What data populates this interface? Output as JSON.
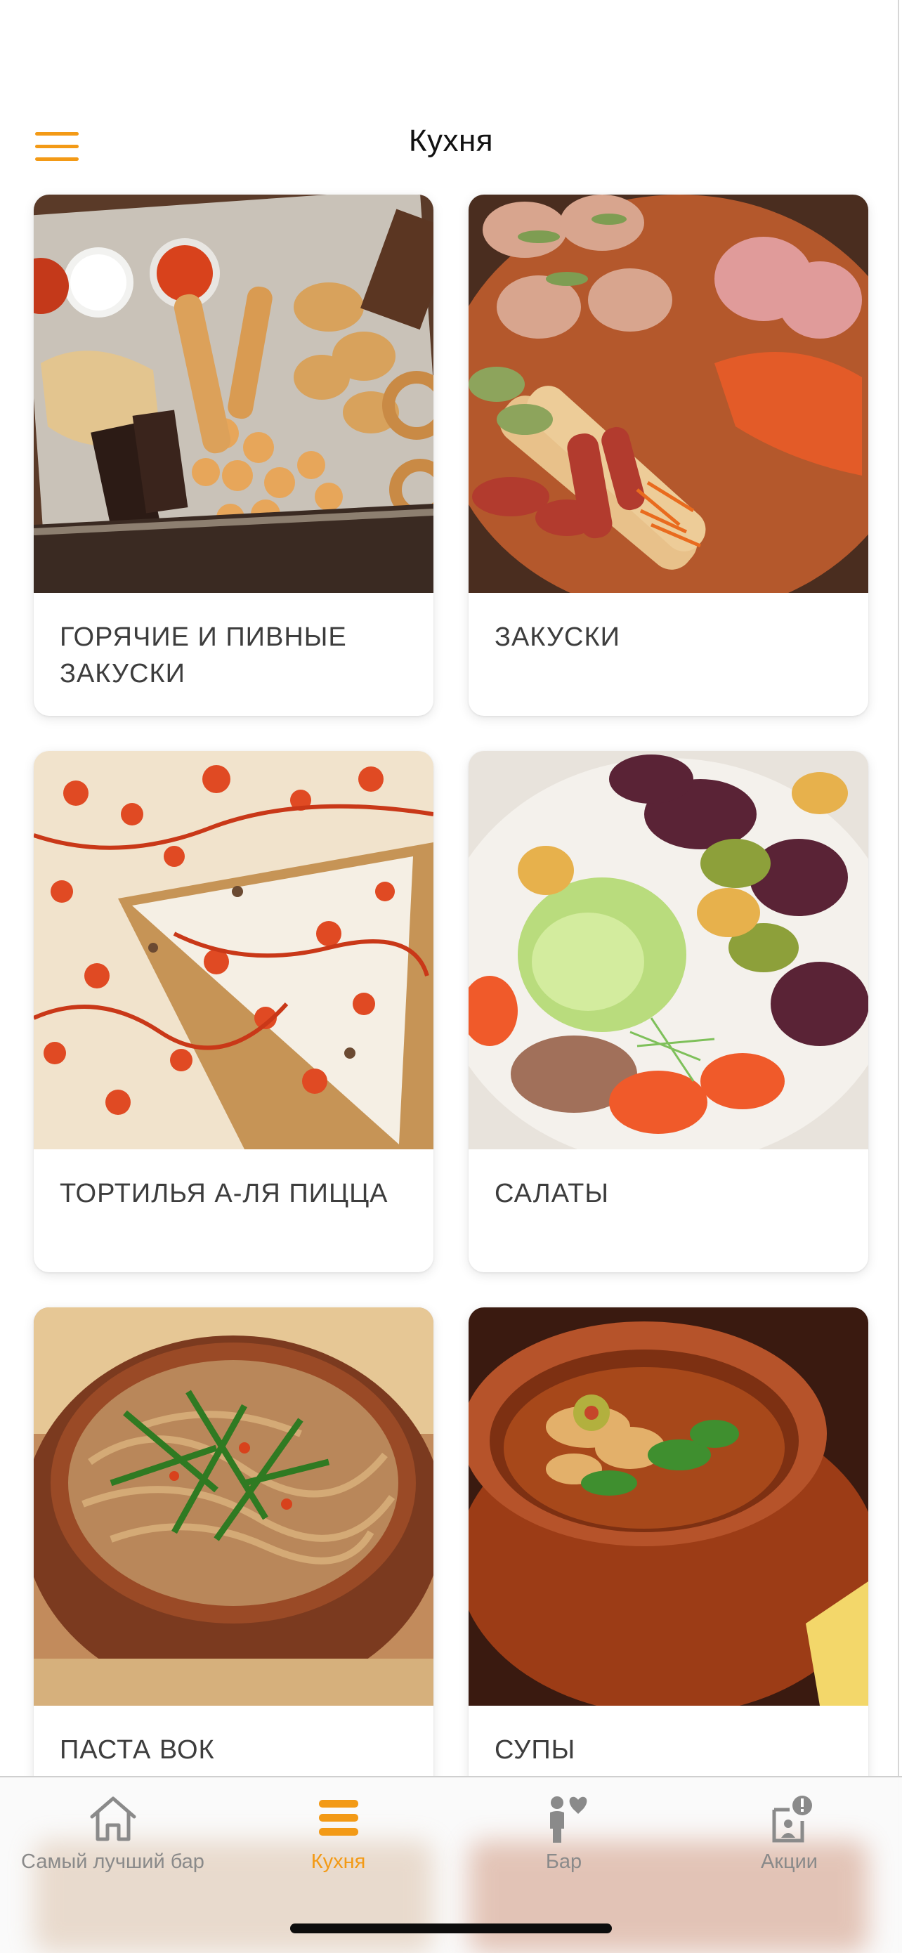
{
  "header": {
    "title": "Кухня",
    "menu_icon": "hamburger-menu-icon"
  },
  "categories": [
    {
      "label": "ГОРЯЧИЕ И ПИВНЫЕ ЗАКУСКИ",
      "image": "hot-snacks-platter"
    },
    {
      "label": "ЗАКУСКИ",
      "image": "cold-cuts-plate"
    },
    {
      "label": "ТОРТИЛЬЯ А-ЛЯ ПИЦЦА",
      "image": "tortilla-pizza"
    },
    {
      "label": "САЛАТЫ",
      "image": "salad-bowl"
    },
    {
      "label": "ПАСТА ВОК",
      "image": "wok-noodles-bowl"
    },
    {
      "label": "СУПЫ",
      "image": "soup-pot"
    }
  ],
  "tabbar": {
    "tabs": [
      {
        "label": "Самый лучший бар",
        "icon": "home-icon",
        "active": false
      },
      {
        "label": "Кухня",
        "icon": "menu-list-icon",
        "active": true
      },
      {
        "label": "Бар",
        "icon": "person-heart-icon",
        "active": false
      },
      {
        "label": "Акции",
        "icon": "promo-alert-icon",
        "active": false
      }
    ]
  },
  "colors": {
    "accent": "#f39a16",
    "inactive": "#8a8a8a",
    "text": "#3d3d3d"
  }
}
